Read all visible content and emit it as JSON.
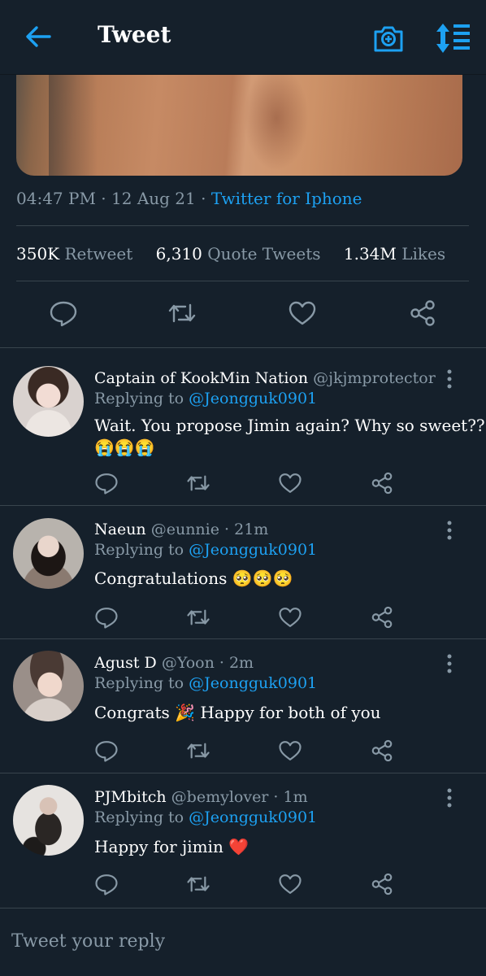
{
  "header": {
    "title": "Tweet",
    "back_icon": "arrow-left-icon",
    "camera_icon": "camera-plus-icon",
    "sort_icon": "sort-icon",
    "accent": "#1da1f2"
  },
  "tweet": {
    "time": "04:47 PM",
    "date": "12 Aug 21",
    "source": "Twitter for Iphone",
    "stats": {
      "retweets": "350K",
      "retweets_label": "Retweet",
      "quotes": "6,310",
      "quotes_label": "Quote Tweets",
      "likes": "1.34M",
      "likes_label": "Likes"
    }
  },
  "replies": [
    {
      "name": "Captain of KookMin Nation",
      "handle": "@jkjmprotector · ...",
      "replying_prefix": "Replying to",
      "replying_to": "@Jeongguk0901",
      "text_line1": "Wait. You propose Jimin again? Why so sweet??",
      "text_line2": "😭😭😭"
    },
    {
      "name": "Naeun",
      "handle": "@eunnie · 21m",
      "replying_prefix": "Replying to",
      "replying_to": "@Jeongguk0901",
      "text_line1": "Congratulations 🥺🥺🥺"
    },
    {
      "name": "Agust D",
      "handle": "@Yoon · 2m",
      "replying_prefix": "Replying to",
      "replying_to": "@Jeongguk0901",
      "text_line1": "Congrats 🎉 Happy for both of you"
    },
    {
      "name": "PJMbitch",
      "handle": "@bemylover · 1m",
      "replying_prefix": "Replying to",
      "replying_to": "@Jeongguk0901",
      "text_line1": "Happy for jimin ❤️"
    }
  ],
  "compose": {
    "placeholder": "Tweet your reply"
  }
}
